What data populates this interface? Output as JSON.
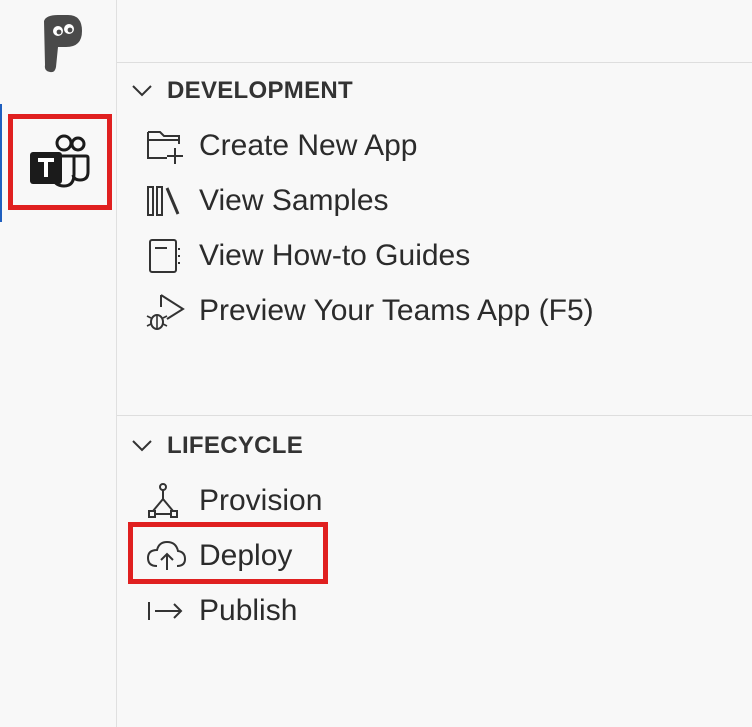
{
  "activity_bar": {
    "icons": [
      "powerplatform-icon",
      "teams-toolkit-icon"
    ]
  },
  "sections": [
    {
      "title": "DEVELOPMENT",
      "items": [
        {
          "label": "Create New App",
          "icon": "new-folder-icon"
        },
        {
          "label": "View Samples",
          "icon": "library-icon"
        },
        {
          "label": "View How-to Guides",
          "icon": "notebook-icon"
        },
        {
          "label": "Preview Your Teams App (F5)",
          "icon": "debug-run-icon"
        }
      ]
    },
    {
      "title": "LIFECYCLE",
      "items": [
        {
          "label": "Provision",
          "icon": "provision-icon"
        },
        {
          "label": "Deploy",
          "icon": "cloud-upload-icon"
        },
        {
          "label": "Publish",
          "icon": "arrow-publish-icon"
        }
      ]
    }
  ],
  "colors": {
    "highlight_box": "#e02020",
    "active_indicator": "#1f5fbf",
    "background": "#f8f8f8"
  }
}
